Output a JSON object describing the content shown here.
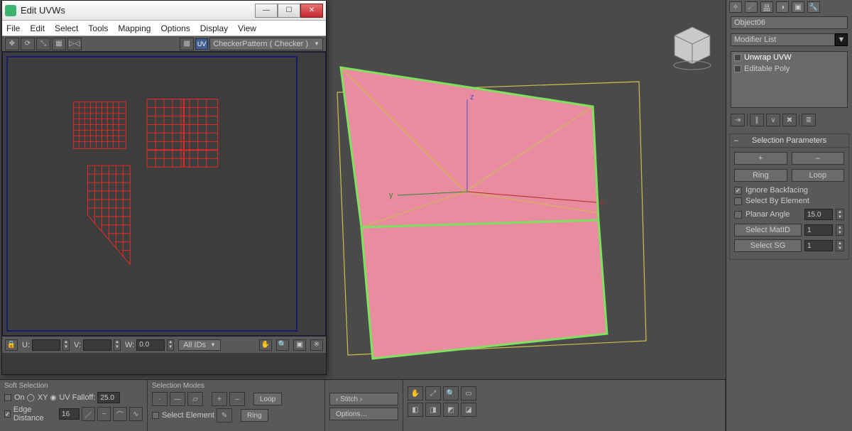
{
  "uvwin": {
    "title": "Edit UVWs",
    "menu": [
      "File",
      "Edit",
      "Select",
      "Tools",
      "Mapping",
      "Options",
      "Display",
      "View"
    ],
    "checker": "CheckerPattern  ( Checker )",
    "status": {
      "u": "",
      "v": "",
      "w": "0.0",
      "idfilter": "All IDs"
    }
  },
  "bottom": {
    "softsel": {
      "title": "Soft Selection",
      "on": "On",
      "xy": "XY",
      "uv": "UV",
      "falloff_lbl": "Falloff:",
      "falloff": "25.0",
      "edge_lbl": "Edge Distance",
      "edge_val": "16"
    },
    "selmodes": {
      "title": "Selection Modes",
      "selelem": "Select Element",
      "loop": "Loop",
      "ring": "Ring",
      "stitch": "‹ Stitch ›",
      "options": "Options…"
    }
  },
  "right": {
    "objectname": "Object06",
    "modlist": "Modifier List",
    "stack": [
      "Unwrap UVW",
      "Editable Poly"
    ],
    "rollout_title": "Selection Parameters",
    "plus": "+",
    "minus": "–",
    "ring": "Ring",
    "loop": "Loop",
    "ignore": "Ignore Backfacing",
    "bysel": "Select By Element",
    "planar": "Planar Angle",
    "planar_val": "15.0",
    "matid": "Select MatID",
    "matid_val": "1",
    "sg": "Select SG",
    "sg_val": "1"
  }
}
